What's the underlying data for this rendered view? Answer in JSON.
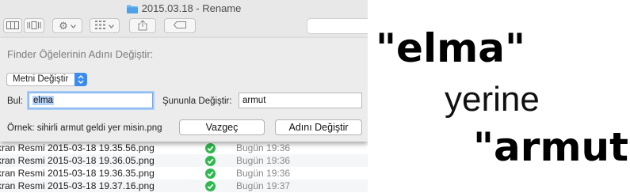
{
  "window": {
    "title": "2015.03.18 - Rename"
  },
  "toolbar": {
    "view_buttons": [
      "columns-view-icon",
      "coverflow-view-icon"
    ],
    "action_button_icon": "gear-icon",
    "arrange_button_icon": "grid-arrange-icon",
    "share_button_icon": "share-icon",
    "tags_button_icon": "tag-icon"
  },
  "rename_sheet": {
    "title": "Finder Öğelerinin Adını Değiştir:",
    "mode_select": {
      "selected": "Metni Değiştir"
    },
    "find_label": "Bul:",
    "find_value": "elma",
    "replace_label": "Şununla Değiştir:",
    "replace_value": "armut",
    "example_text": "Örnek: sihirli armut geldi yer misin.png",
    "cancel_label": "Vazgeç",
    "rename_label": "Adını Değiştir"
  },
  "file_list": {
    "rows": [
      {
        "name": "kran Resmi 2015-03-18 19.35.56.png",
        "status_icon": "green-check-icon",
        "date": "Bugün 19:36"
      },
      {
        "name": "kran Resmi 2015-03-18 19.36.05.png",
        "status_icon": "green-check-icon",
        "date": "Bugün 19:36"
      },
      {
        "name": "kran Resmi 2015-03-18 19.36.35.png",
        "status_icon": "green-check-icon",
        "date": "Bugün 19:36"
      },
      {
        "name": "kran Resmi 2015-03-18 19.37.16.png",
        "status_icon": "green-check-icon",
        "date": "Bugün 19:37"
      }
    ]
  },
  "caption": {
    "line1": "\"elma\"",
    "line2": "yerine",
    "line3": "\"armut\""
  },
  "colors": {
    "accent_blue": "#3b8cf0",
    "check_green": "#2fb84f",
    "sheet_bg": "#ececec"
  }
}
